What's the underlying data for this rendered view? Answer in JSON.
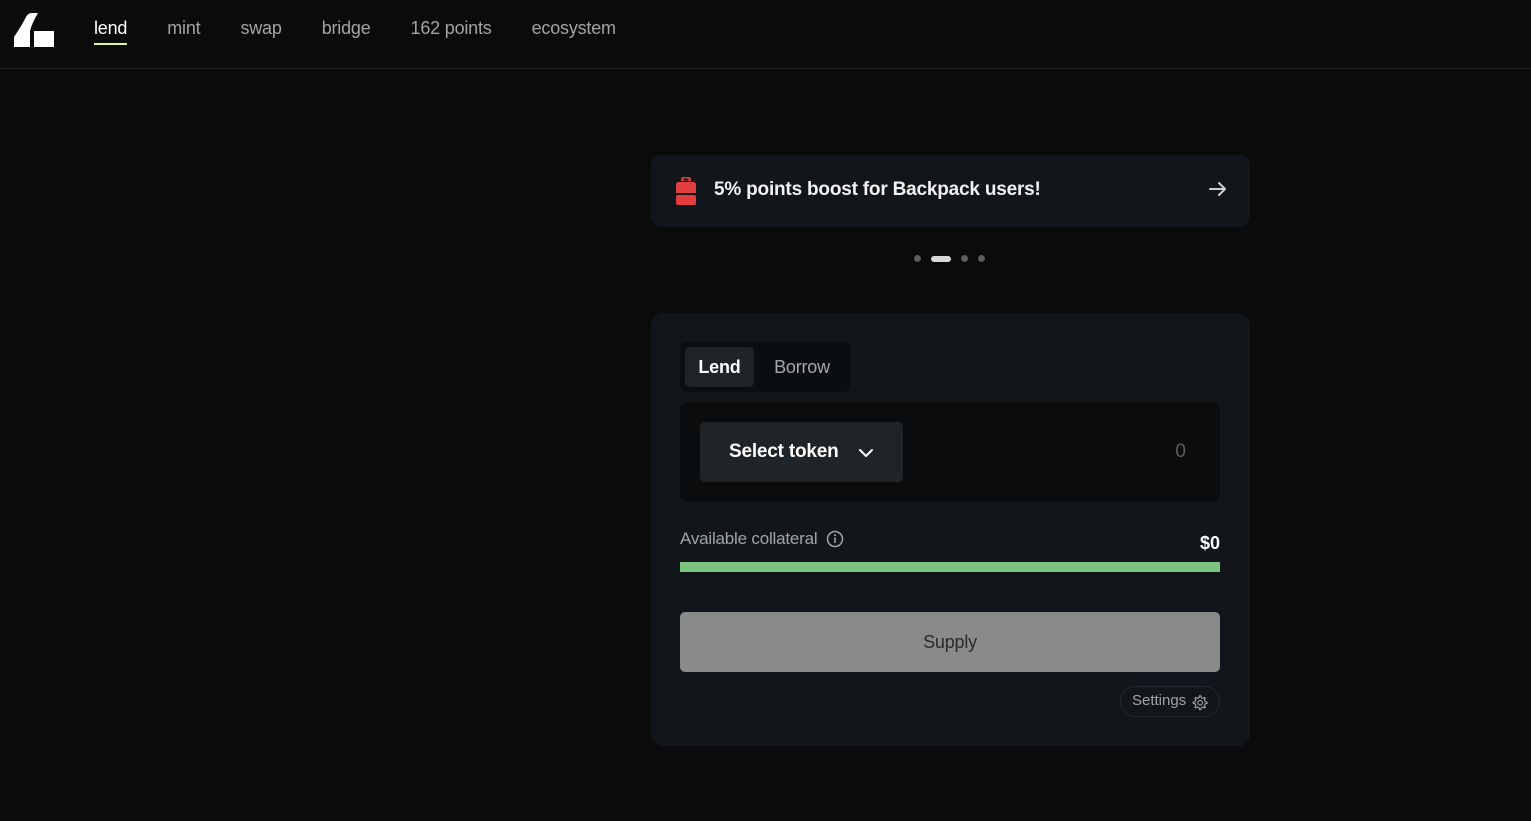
{
  "nav": {
    "items": [
      {
        "label": "lend",
        "active": true
      },
      {
        "label": "mint",
        "active": false
      },
      {
        "label": "swap",
        "active": false
      },
      {
        "label": "bridge",
        "active": false
      },
      {
        "label": "162 points",
        "active": false
      },
      {
        "label": "ecosystem",
        "active": false
      }
    ]
  },
  "banner": {
    "text": "5% points boost for Backpack users!",
    "icon": "backpack-icon",
    "arrow_icon": "arrow-right-icon"
  },
  "carousel": {
    "total_slides": 4,
    "active_index": 1
  },
  "card": {
    "tabs": [
      {
        "label": "Lend",
        "active": true
      },
      {
        "label": "Borrow",
        "active": false
      }
    ],
    "select_token_label": "Select token",
    "amount_placeholder": "0",
    "collateral": {
      "label": "Available collateral",
      "value": "$0",
      "fill_percent": 100
    },
    "supply_label": "Supply",
    "settings_label": "Settings"
  },
  "colors": {
    "accent_underline": "#d9f99d",
    "progress_fill": "#7ac47f",
    "backpack_red": "#e33e3f"
  }
}
